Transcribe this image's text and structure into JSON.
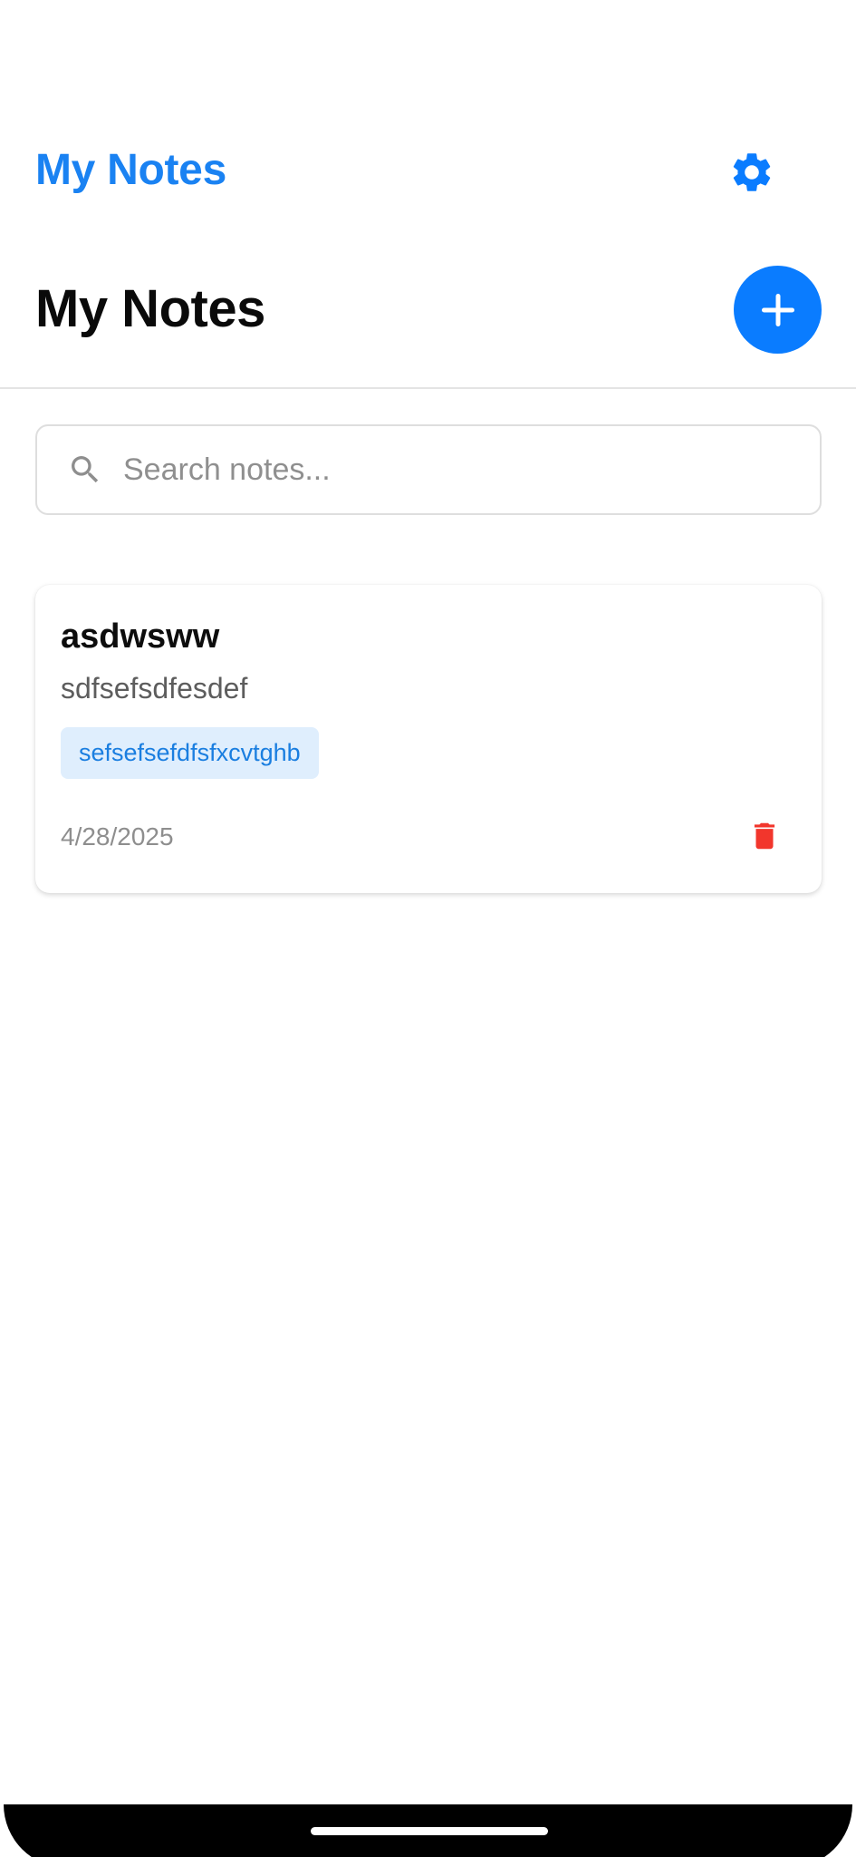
{
  "app_bar": {
    "title": "My Notes",
    "settings_icon": "gear-icon"
  },
  "header": {
    "title": "My Notes",
    "add_icon": "plus-icon"
  },
  "search": {
    "placeholder": "Search notes...",
    "value": "",
    "icon": "search-icon"
  },
  "notes": [
    {
      "title": "asdwsww",
      "body": "sdfsefsdfesdef",
      "tag": "sefsefsefdfsfxcvtghb",
      "date": "4/28/2025",
      "delete_icon": "trash-icon"
    }
  ],
  "colors": {
    "accent": "#0a7cff",
    "app_title": "#1a82f2",
    "tag_background": "#dfeefd",
    "tag_text": "#1a7ee0",
    "delete": "#f2362c"
  }
}
